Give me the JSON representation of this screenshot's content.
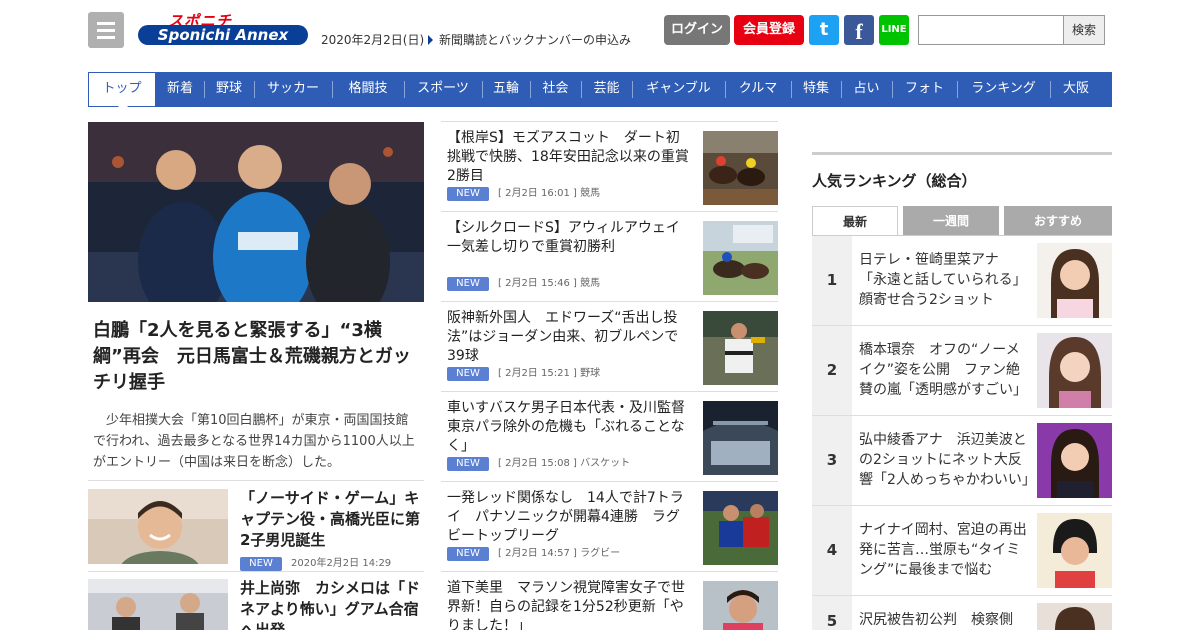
{
  "header": {
    "logo_top": "スポニチ",
    "logo_main": "Sponichi Annex",
    "date": "2020年2月2日(日)",
    "subscription_link": "新聞購読とバックナンバーの申込み",
    "login_label": "ログイン",
    "register_label": "会員登録",
    "twitter_glyph": "t",
    "facebook_glyph": "f",
    "line_label": "LINE",
    "search_placeholder": "",
    "search_label": "検索"
  },
  "nav": {
    "items": [
      "トップ",
      "新着",
      "野球",
      "サッカー",
      "格闘技",
      "スポーツ",
      "五輪",
      "社会",
      "芸能",
      "ギャンブル",
      "クルマ",
      "特集",
      "占い",
      "フォト",
      "ランキング",
      "大阪"
    ],
    "active": "トップ"
  },
  "hero": {
    "title": "白鵬「2人を見ると緊張する」“3横綱”再会　元日馬富士＆荒磯親方とガッチリ握手",
    "lead": "少年相撲大会「第10回白鵬杯」が東京・両国国技館で行われ、過去最多となる世界14カ国から1100人以上がエントリー（中国は来日を断念）した。"
  },
  "left_list": [
    {
      "title": "「ノーサイド・ゲーム」キャプテン役・高橋光臣に第2子男児誕生",
      "badge": "NEW",
      "time": "2020年2月2日 14:29"
    },
    {
      "title": "井上尚弥　カシメロは「ドネアより怖い」グアム合宿へ出発",
      "badge": "",
      "time": ""
    }
  ],
  "mid_list": [
    {
      "title": "【根岸S】モズアスコット　ダート初挑戦で快勝、18年安田記念以来の重賞2勝目",
      "badge": "NEW",
      "time": "[ 2月2日 16:01 ]",
      "category": "競馬"
    },
    {
      "title": "【シルクロードS】アウィルアウェイ　一気差し切りで重賞初勝利",
      "badge": "NEW",
      "time": "[ 2月2日 15:46 ]",
      "category": "競馬"
    },
    {
      "title": "阪神新外国人　エドワーズ“舌出し投法”はジョーダン由来、初ブルペンで39球",
      "badge": "NEW",
      "time": "[ 2月2日 15:21 ]",
      "category": "野球"
    },
    {
      "title": "車いすバスケ男子日本代表・及川監督　東京パラ除外の危機も「ぶれることなく」",
      "badge": "NEW",
      "time": "[ 2月2日 15:08 ]",
      "category": "バスケット"
    },
    {
      "title": "一発レッド関係なし　14人で計7トライ　パナソニックが開幕4連勝　ラグビートップリーグ",
      "badge": "NEW",
      "time": "[ 2月2日 14:57 ]",
      "category": "ラグビー"
    },
    {
      "title": "道下美里　マラソン視覚障害女子で世界新！自らの記録を1分52秒更新「やりました！」",
      "badge": "",
      "time": "",
      "category": ""
    }
  ],
  "ranking": {
    "heading": "人気ランキング（総合）",
    "tabs": [
      "最新",
      "一週間",
      "おすすめ"
    ],
    "items": [
      {
        "rank": "1",
        "title": "日テレ・笹崎里菜アナ　「永遠と話していられる」顔寄せ合う2ショット"
      },
      {
        "rank": "2",
        "title": "橋本環奈　オフの“ノーメイク”姿を公開　ファン絶賛の嵐「透明感がすごい」"
      },
      {
        "rank": "3",
        "title": "弘中綾香アナ　浜辺美波との2ショットにネット大反響「2人めっちゃかわいい」"
      },
      {
        "rank": "4",
        "title": "ナイナイ岡村、宮迫の再出発に苦言…蛍原も“タイミング”に最後まで悩む"
      },
      {
        "rank": "5",
        "title": "沢尻被告初公判　検察側"
      }
    ]
  },
  "colors": {
    "nav_blue": "#2f5cb5",
    "brand_red": "#e60012",
    "badge_blue": "#5b7fd1"
  }
}
